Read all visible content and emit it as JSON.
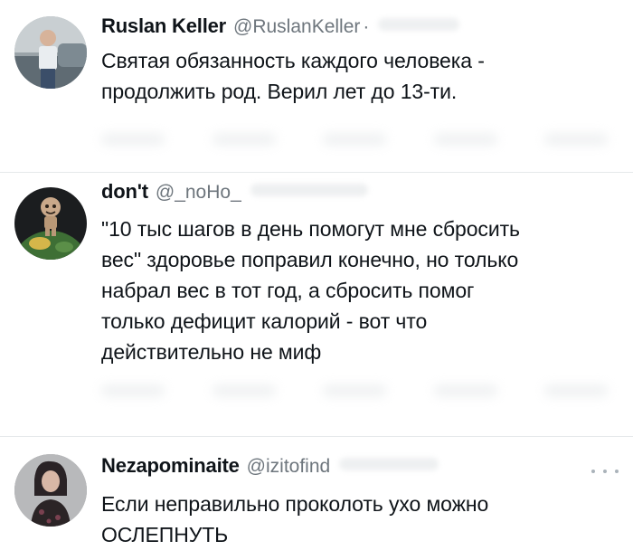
{
  "tweets": [
    {
      "display_name": "Ruslan Keller",
      "handle": "@RuslanKeller",
      "separator": "·",
      "text": "Святая обязанность каждого человека -\nпродолжить род. Верил лет до 13-ти.",
      "avatar_icon": "user-photo-icon"
    },
    {
      "display_name": "don't",
      "handle": "@_noHo_",
      "text": "\"10 тыс шагов в день помогут мне сбросить\nвес\" здоровье поправил конечно, но только\nнабрал вес в тот год, а сбросить помог\nтолько дефицит калорий - вот что\nдействительно не миф",
      "avatar_icon": "sackboy-globe-icon"
    },
    {
      "display_name": "Nezapominaite",
      "handle": "@izitofind",
      "text": "Если неправильно проколоть ухо можно\nОСЛЕПНУТЬ",
      "avatar_icon": "user-photo-icon",
      "more_icon": "more-options-icon"
    }
  ],
  "colors": {
    "text": "#0f1419",
    "secondary": "#6e767d",
    "divider": "#e6e9eb",
    "background": "#ffffff"
  }
}
